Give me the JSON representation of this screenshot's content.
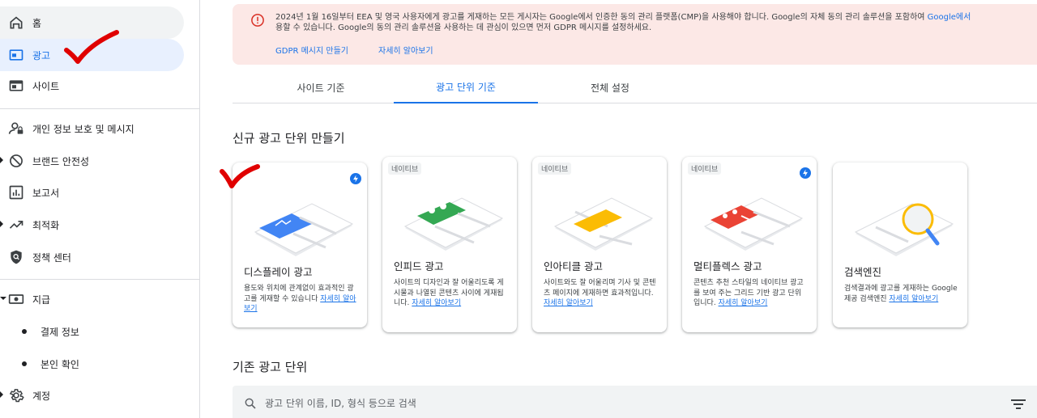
{
  "sidebar": {
    "items": [
      {
        "label": "홈",
        "icon": "home-icon"
      },
      {
        "label": "광고",
        "icon": "ads-icon"
      },
      {
        "label": "사이트",
        "icon": "sites-icon"
      },
      {
        "label": "개인 정보 보호 및 메시지",
        "icon": "privacy-icon"
      },
      {
        "label": "브랜드 안전성",
        "icon": "block-icon"
      },
      {
        "label": "보고서",
        "icon": "reports-icon"
      },
      {
        "label": "최적화",
        "icon": "trend-icon"
      },
      {
        "label": "정책 센터",
        "icon": "policy-shield-icon"
      },
      {
        "label": "지급",
        "icon": "payments-icon"
      },
      {
        "label": "결제 정보",
        "icon": "dot-icon"
      },
      {
        "label": "본인 확인",
        "icon": "dot-icon"
      },
      {
        "label": "계정",
        "icon": "gear-icon"
      }
    ]
  },
  "banner": {
    "message_part1": "2024년 1월 16일부터 EEA 및 영국 사용자에게 광고를 게재하는 모든 게시자는 Google에서 인증한 동의 관리 플랫폼(CMP)을 사용해야 합니다. Google의 자체 동의 관리 솔루션을 포함하여 ",
    "message_link": "Google에서",
    "message_part2": "용할 수 있습니다. Google의 동의 관리 솔루션을 사용하는 데 관심이 있으면 먼저 GDPR 메시지를 설정하세요.",
    "action_create": "GDPR 메시지 만들기",
    "action_learn": "자세히 알아보기"
  },
  "tabs": [
    {
      "label": "사이트 기준"
    },
    {
      "label": "광고 단위 기준"
    },
    {
      "label": "전체 설정"
    }
  ],
  "new_section_title": "신규 광고 단위 만들기",
  "cards": [
    {
      "badge": "",
      "title": "디스플레이 광고",
      "desc": "용도와 위치에 관계없이 효과적인 광고를 게재할 수 있습니다 ",
      "more": "자세히 알아보기",
      "accent": "#4285f4"
    },
    {
      "badge": "네이티브",
      "title": "인피드 광고",
      "desc": "사이트의 디자인과 잘 어울리도록 게시물과 나열된 콘텐츠 사이에 게재됩니다. ",
      "more": "자세히 알아보기",
      "accent": "#34a853"
    },
    {
      "badge": "네이티브",
      "title": "인아티클 광고",
      "desc": "사이트와도 잘 어울리며 기사 및 콘텐츠 페이지에 게재하면 효과적입니다. ",
      "more": "자세히 알아보기",
      "accent": "#fbbc04"
    },
    {
      "badge": "네이티브",
      "title": "멀티플렉스 광고",
      "desc": "콘텐츠 추천 스타일의 네이티브 광고를 보여 주는 그리드 기반 광고 단위입니다. ",
      "more": "자세히 알아보기",
      "accent": "#ea4335"
    },
    {
      "badge": "",
      "title": "검색엔진",
      "desc": "검색결과에 광고를 게재하는 Google 제공 검색엔진 ",
      "more": "자세히 알아보기",
      "accent": "#fbbc04"
    }
  ],
  "existing_section_title": "기존 광고 단위",
  "search": {
    "placeholder": "광고 단위 이름, ID, 형식 등으로 검색"
  },
  "colors": {
    "accent": "#1a73e8",
    "banner_bg": "#fce8e6",
    "error_red": "#d93025",
    "annotation_red": "#e00000"
  }
}
